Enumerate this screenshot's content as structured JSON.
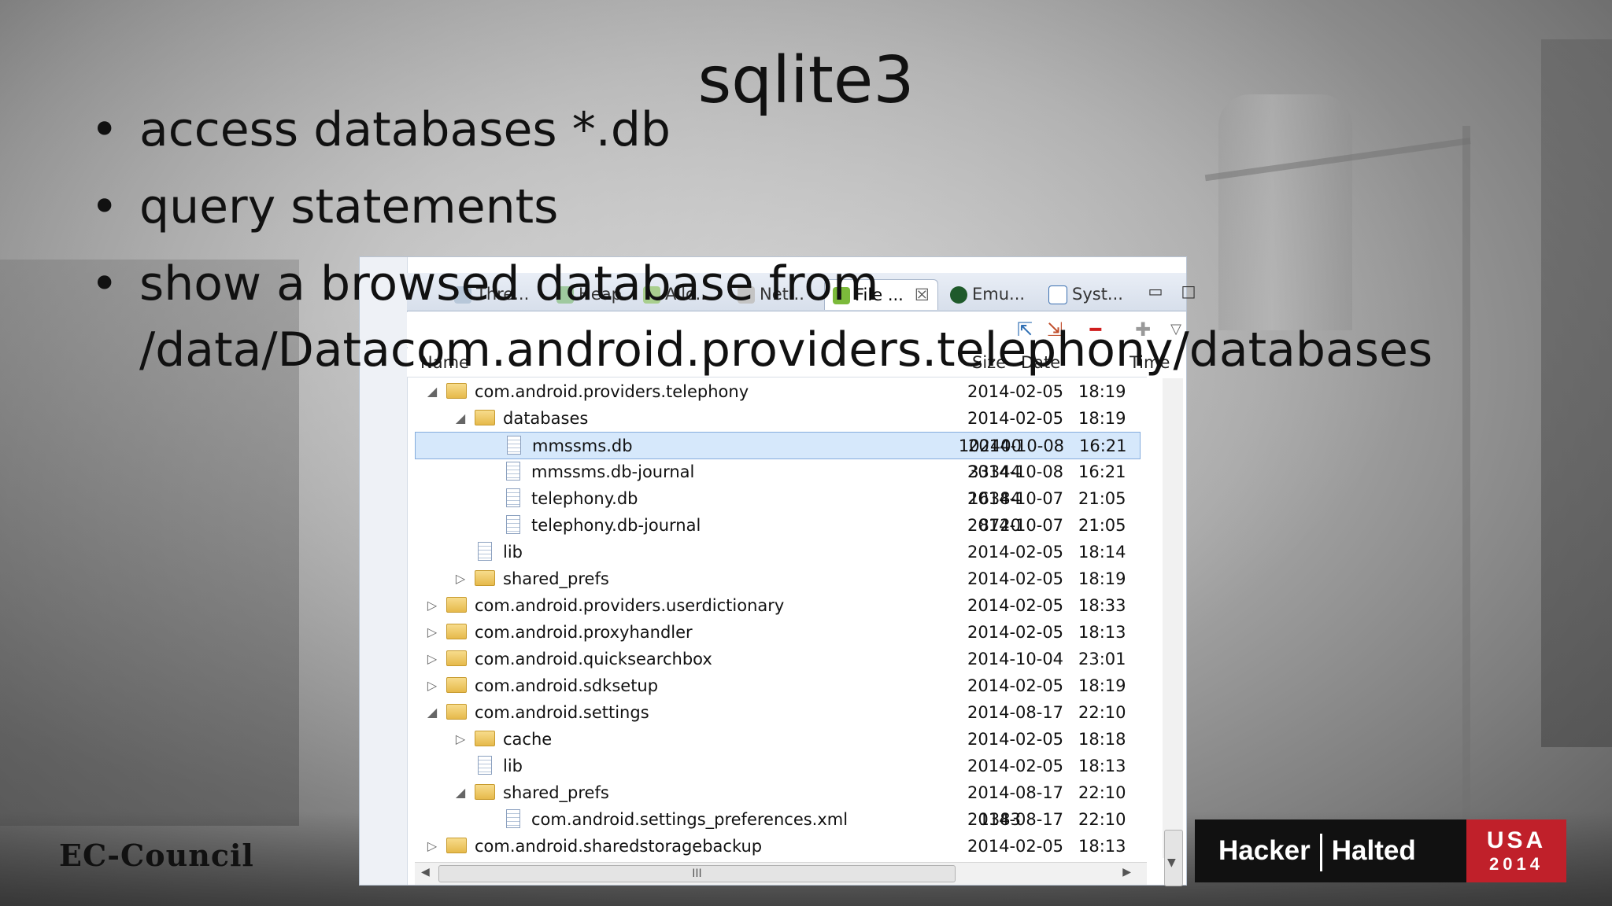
{
  "slide": {
    "title": "sqlite3",
    "bullets": [
      {
        "dot": "•",
        "text": "access databases *.db"
      },
      {
        "dot": "•",
        "text": "query statements"
      },
      {
        "dot": "•",
        "text": "show a browsed database from"
      },
      {
        "dot": "",
        "text": "/data/Datacom.android.providers.telephony/databases"
      }
    ]
  },
  "panel": {
    "tabs": [
      "Thre...",
      "Heap",
      "Allo...",
      "Net...",
      "File ...",
      "Emu...",
      "Syst..."
    ],
    "tab_close": "☒",
    "columns": {
      "name": "Name",
      "size": "Size",
      "date": "Date",
      "time": "Time"
    },
    "rows": [
      {
        "indent": 0,
        "expander": "open",
        "kind": "folder",
        "name": "com.android.providers.telephony",
        "size": "",
        "date": "2014-02-05",
        "time": "18:19"
      },
      {
        "indent": 1,
        "expander": "open",
        "kind": "folder",
        "name": "databases",
        "size": "",
        "date": "2014-02-05",
        "time": "18:19"
      },
      {
        "indent": 2,
        "expander": "none",
        "kind": "file",
        "name": "mmssms.db",
        "size": "102400",
        "date": "2014-10-08",
        "time": "16:21",
        "selected": true
      },
      {
        "indent": 2,
        "expander": "none",
        "kind": "file",
        "name": "mmssms.db-journal",
        "size": "33344",
        "date": "2014-10-08",
        "time": "16:21"
      },
      {
        "indent": 2,
        "expander": "none",
        "kind": "file",
        "name": "telephony.db",
        "size": "16384",
        "date": "2014-10-07",
        "time": "21:05"
      },
      {
        "indent": 2,
        "expander": "none",
        "kind": "file",
        "name": "telephony.db-journal",
        "size": "8720",
        "date": "2014-10-07",
        "time": "21:05"
      },
      {
        "indent": 1,
        "expander": "none",
        "kind": "file",
        "name": "lib",
        "size": "",
        "date": "2014-02-05",
        "time": "18:14"
      },
      {
        "indent": 1,
        "expander": "closed",
        "kind": "folder",
        "name": "shared_prefs",
        "size": "",
        "date": "2014-02-05",
        "time": "18:19"
      },
      {
        "indent": 0,
        "expander": "closed",
        "kind": "folder",
        "name": "com.android.providers.userdictionary",
        "size": "",
        "date": "2014-02-05",
        "time": "18:33"
      },
      {
        "indent": 0,
        "expander": "closed",
        "kind": "folder",
        "name": "com.android.proxyhandler",
        "size": "",
        "date": "2014-02-05",
        "time": "18:13"
      },
      {
        "indent": 0,
        "expander": "closed",
        "kind": "folder",
        "name": "com.android.quicksearchbox",
        "size": "",
        "date": "2014-10-04",
        "time": "23:01"
      },
      {
        "indent": 0,
        "expander": "closed",
        "kind": "folder",
        "name": "com.android.sdksetup",
        "size": "",
        "date": "2014-02-05",
        "time": "18:19"
      },
      {
        "indent": 0,
        "expander": "open",
        "kind": "folder",
        "name": "com.android.settings",
        "size": "",
        "date": "2014-08-17",
        "time": "22:10"
      },
      {
        "indent": 1,
        "expander": "closed",
        "kind": "folder",
        "name": "cache",
        "size": "",
        "date": "2014-02-05",
        "time": "18:18"
      },
      {
        "indent": 1,
        "expander": "none",
        "kind": "file",
        "name": "lib",
        "size": "",
        "date": "2014-02-05",
        "time": "18:13"
      },
      {
        "indent": 1,
        "expander": "open",
        "kind": "folder",
        "name": "shared_prefs",
        "size": "",
        "date": "2014-08-17",
        "time": "22:10"
      },
      {
        "indent": 2,
        "expander": "none",
        "kind": "file",
        "name": "com.android.settings_preferences.xml",
        "size": "1383",
        "date": "2014-08-17",
        "time": "22:10"
      },
      {
        "indent": 0,
        "expander": "closed",
        "kind": "folder",
        "name": "com.android.sharedstoragebackup",
        "size": "",
        "date": "2014-02-05",
        "time": "18:13"
      }
    ],
    "hscroll_grip": "III"
  },
  "branding": {
    "ec_council": "EC-Council",
    "hacker": "Hacker",
    "halted": "Halted",
    "usa": "USA",
    "year": "2014"
  }
}
